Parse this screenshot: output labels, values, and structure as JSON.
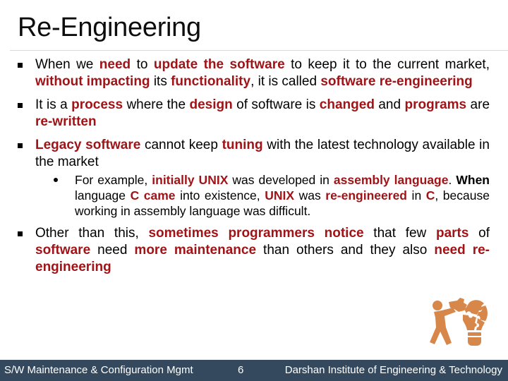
{
  "slide": {
    "title": "Re-Engineering",
    "accent_color": "#a01418",
    "bullets": [
      {
        "segments": [
          {
            "text": "When we ",
            "style": "normal"
          },
          {
            "text": "need",
            "style": "highlight"
          },
          {
            "text": " to ",
            "style": "normal"
          },
          {
            "text": "update the software",
            "style": "highlight"
          },
          {
            "text": " to keep it to the current market, ",
            "style": "normal"
          },
          {
            "text": "without impacting",
            "style": "highlight"
          },
          {
            "text": " its ",
            "style": "normal"
          },
          {
            "text": "functionality",
            "style": "highlight"
          },
          {
            "text": ", it is called ",
            "style": "normal"
          },
          {
            "text": "software re-engineering",
            "style": "highlight"
          }
        ]
      },
      {
        "segments": [
          {
            "text": "It is a ",
            "style": "normal"
          },
          {
            "text": "process",
            "style": "highlight"
          },
          {
            "text": " where the ",
            "style": "normal"
          },
          {
            "text": "design",
            "style": "highlight"
          },
          {
            "text": " of software is ",
            "style": "normal"
          },
          {
            "text": "changed",
            "style": "highlight"
          },
          {
            "text": " and ",
            "style": "normal"
          },
          {
            "text": "programs",
            "style": "highlight"
          },
          {
            "text": " are ",
            "style": "normal"
          },
          {
            "text": "re-written",
            "style": "highlight"
          }
        ]
      },
      {
        "segments": [
          {
            "text": "Legacy software",
            "style": "highlight"
          },
          {
            "text": " cannot keep ",
            "style": "normal"
          },
          {
            "text": "tuning",
            "style": "highlight"
          },
          {
            "text": " with the latest technology available in the market",
            "style": "normal"
          }
        ],
        "sub_bullets": [
          {
            "segments": [
              {
                "text": "For example, ",
                "style": "normal"
              },
              {
                "text": "initially UNIX",
                "style": "highlight"
              },
              {
                "text": " was developed in ",
                "style": "normal"
              },
              {
                "text": "assembly language",
                "style": "highlight"
              },
              {
                "text": ". ",
                "style": "normal"
              },
              {
                "text": "When",
                "style": "bold"
              },
              {
                "text": " language ",
                "style": "normal"
              },
              {
                "text": "C came",
                "style": "highlight"
              },
              {
                "text": " into existence, ",
                "style": "normal"
              },
              {
                "text": "UNIX",
                "style": "highlight"
              },
              {
                "text": " was ",
                "style": "normal"
              },
              {
                "text": "re-engineered",
                "style": "highlight"
              },
              {
                "text": " in ",
                "style": "normal"
              },
              {
                "text": "C",
                "style": "highlight"
              },
              {
                "text": ", because working in assembly language was difficult.",
                "style": "normal"
              }
            ]
          }
        ]
      },
      {
        "segments": [
          {
            "text": "Other than this, ",
            "style": "normal"
          },
          {
            "text": "sometimes programmers notice",
            "style": "highlight"
          },
          {
            "text": " that few ",
            "style": "normal"
          },
          {
            "text": "parts",
            "style": "highlight"
          },
          {
            "text": " of ",
            "style": "normal"
          },
          {
            "text": "software",
            "style": "highlight"
          },
          {
            "text": " need ",
            "style": "normal"
          },
          {
            "text": "more maintenance",
            "style": "highlight"
          },
          {
            "text": " than others and they also ",
            "style": "normal"
          },
          {
            "text": "need re-engineering",
            "style": "highlight"
          }
        ]
      }
    ],
    "illustration": {
      "icon": "person-assembling-puzzle-lightbulb-icon",
      "color": "#d8874a"
    }
  },
  "footer": {
    "course": "S/W Maintenance & Configuration Mgmt",
    "page_number": "6",
    "institute": "Darshan Institute of Engineering & Technology",
    "background": "#34495e"
  }
}
